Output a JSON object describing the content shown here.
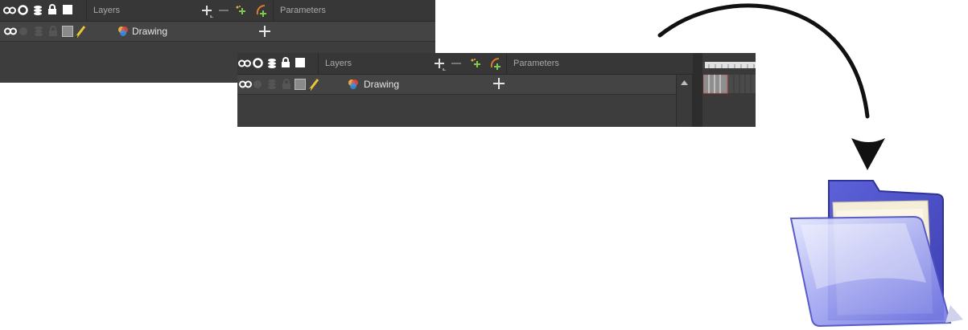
{
  "colors": {
    "panel_bg": "#3d3d3d",
    "toolbar_bg": "#373737",
    "row_bg": "#444444",
    "pencil": "#e8c53a",
    "arrow": "#111111",
    "folder_blue": "#5f63d8"
  },
  "panel_before": {
    "toolbar": {
      "layers_label": "Layers",
      "parameters_label": "Parameters",
      "icons": [
        "onion-skin-icon",
        "solo-icon",
        "stack-icon",
        "lock-icon",
        "color-swatch-icon",
        "add-layer-icon",
        "remove-layer-icon",
        "add-peg-icon",
        "add-deformer-icon"
      ]
    },
    "layer_row": {
      "name": "Drawing",
      "icons": [
        "onion-skin-icon",
        "solo-icon",
        "stack-icon",
        "lock-icon",
        "color-swatch-icon",
        "pencil-icon",
        "drawing-layer-icon",
        "expand-plus-icon"
      ]
    }
  },
  "panel_after": {
    "toolbar": {
      "layers_label": "Layers",
      "parameters_label": "Parameters",
      "icons": [
        "onion-skin-icon",
        "solo-icon",
        "stack-icon",
        "lock-icon",
        "color-swatch-icon",
        "add-layer-icon",
        "remove-layer-icon",
        "add-peg-icon",
        "add-deformer-icon"
      ]
    },
    "layer_row": {
      "name": "Drawing",
      "icons": [
        "onion-skin-icon",
        "solo-icon",
        "stack-icon",
        "lock-icon",
        "color-swatch-icon",
        "pencil-icon",
        "drawing-layer-icon",
        "expand-plus-icon"
      ]
    },
    "scrollbar": {
      "arrow": "scroll-up-icon"
    },
    "timeline": {
      "icons": [
        "frame-ruler-icon",
        "frame-cells-icon"
      ]
    }
  },
  "decor": {
    "icons": [
      "curved-arrow-icon",
      "open-folder-icon"
    ]
  }
}
